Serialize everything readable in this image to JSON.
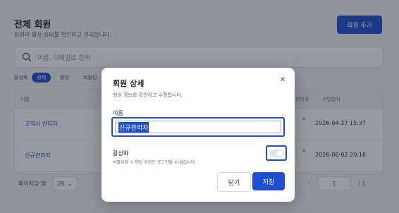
{
  "header": {
    "title": "전체 회원",
    "subtitle": "회원의 활성 상태를 확인하고 관리합니다.",
    "add_button": "회원 추가"
  },
  "search": {
    "placeholder": "이름, 이메일로 검색"
  },
  "filters": {
    "label": "활성화",
    "chips": [
      "전체",
      "활성",
      "비활성"
    ]
  },
  "table": {
    "headers": {
      "name": "이름",
      "col_admin": "관리자",
      "joined": "가입일자"
    },
    "rows": [
      {
        "name": "고객사 관리자",
        "joined": "2026-04-27 15:37"
      },
      {
        "name": "신규관리자",
        "joined": "2026-06-02 20:16"
      }
    ]
  },
  "footer": {
    "per_page_label": "페이지당 행",
    "per_page_value": "20",
    "page_current": "1",
    "page_total": "/ 1"
  },
  "modal": {
    "title": "회원 상세",
    "subtitle": "회원 정보를 확인하고 수정합니다.",
    "name_label": "이름",
    "name_value": "신규관리자",
    "active_label": "활성화",
    "active_help": "비활성화 시 해당 회원은 로그인할 수 없습니다.",
    "active_on": false,
    "close_button": "닫기",
    "save_button": "저장"
  },
  "colors": {
    "accent": "#1f4fd1",
    "overlay": "rgba(25,30,40,0.45)"
  }
}
